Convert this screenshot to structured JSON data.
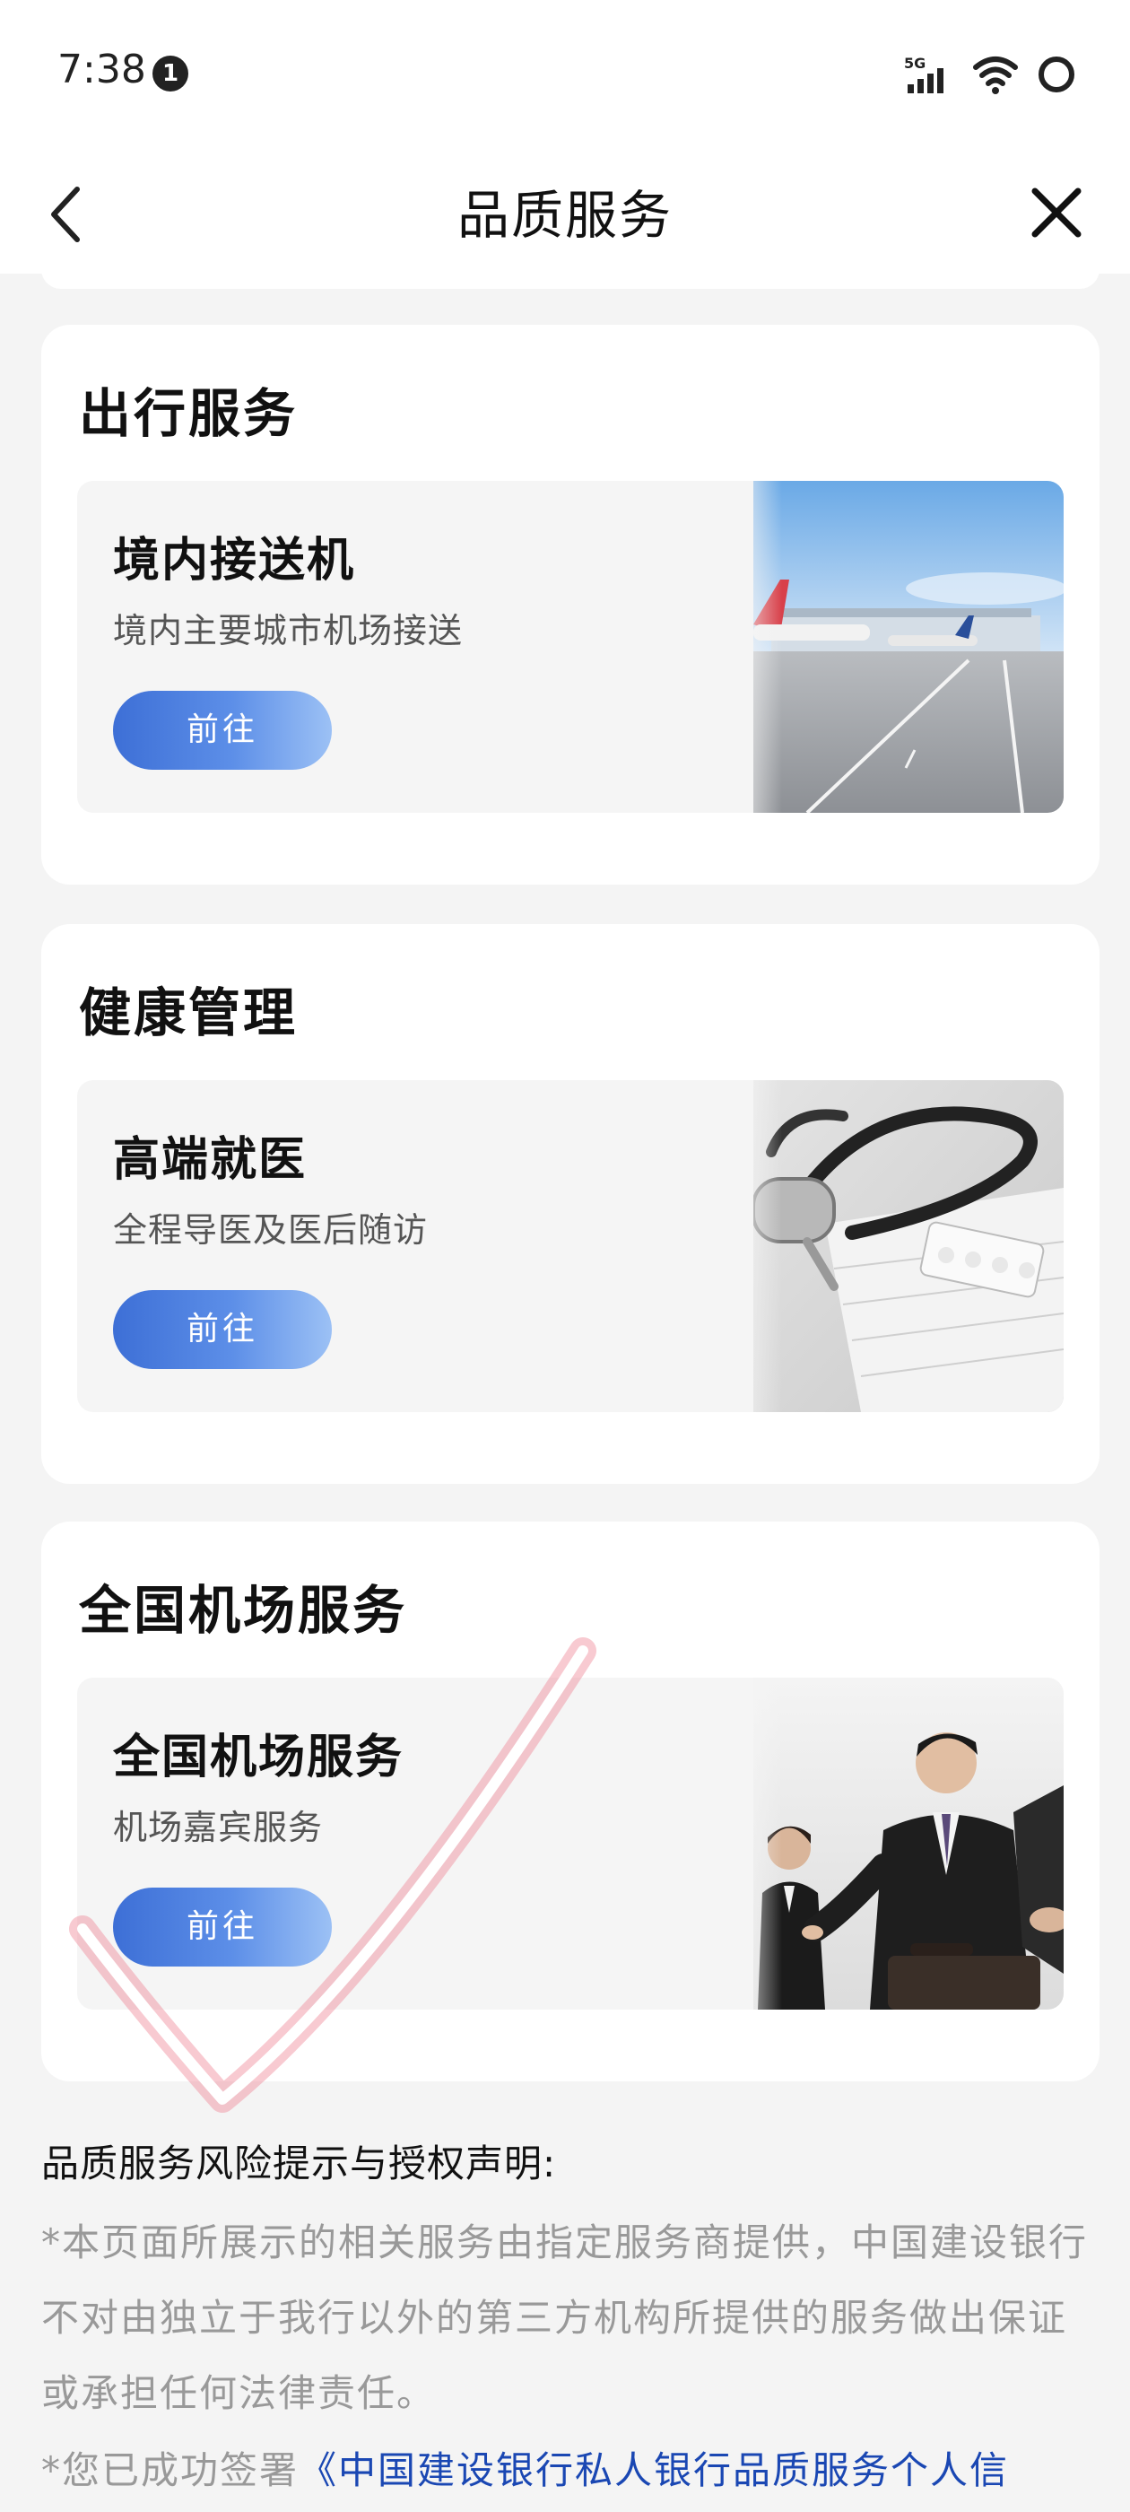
{
  "status_bar": {
    "time": "7:38",
    "notification_count": "1",
    "network": "5G",
    "icons": [
      "signal-icon",
      "wifi-icon",
      "battery-icon"
    ]
  },
  "header": {
    "title": "品质服务",
    "back_icon": "chevron-left-icon",
    "close_icon": "close-icon"
  },
  "sections": [
    {
      "title": "出行服务",
      "card": {
        "name": "境内接送机",
        "desc": "境内主要城市机场接送",
        "button": "前往",
        "image": "airport-runway-image"
      }
    },
    {
      "title": "健康管理",
      "card": {
        "name": "高端就医",
        "desc": "全程导医及医后随访",
        "button": "前往",
        "image": "stethoscope-image"
      }
    },
    {
      "title": "全国机场服务",
      "card": {
        "name": "全国机场服务",
        "desc": "机场嘉宾服务",
        "button": "前往",
        "image": "airport-staff-image"
      }
    }
  ],
  "notice": {
    "title": "品质服务风险提示与授权声明:",
    "body": "*本页面所展示的相关服务由指定服务商提供，中国建设银行不对由独立于我行以外的第三方机构所提供的服务做出保证或承担任何法律责任。",
    "line2_prefix": "*您已成功签署",
    "line2_link": "《中国建设银行私人银行品质服务个人信"
  },
  "colors": {
    "accent": "#3d6fd6",
    "link": "#1a47b3",
    "annotation": "#f08a9a"
  }
}
